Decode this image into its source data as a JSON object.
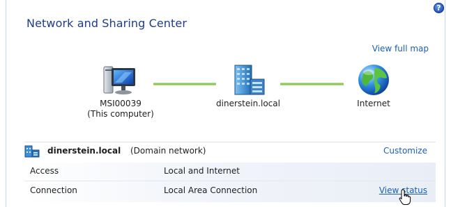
{
  "header": {
    "title": "Network and Sharing Center",
    "help_glyph": "?",
    "view_full_map": "View full map"
  },
  "map": {
    "computer": {
      "name": "MSI00039",
      "subtitle": "(This computer)"
    },
    "domain": {
      "name": "dinerstein.local"
    },
    "internet": {
      "name": "Internet"
    }
  },
  "network": {
    "name": "dinerstein.local",
    "type": "(Domain network)",
    "customize": "Customize",
    "rows": [
      {
        "label": "Access",
        "value": "Local and Internet",
        "action": ""
      },
      {
        "label": "Connection",
        "value": "Local Area Connection",
        "action": "View status"
      }
    ]
  },
  "colors": {
    "title": "#1e3c8c",
    "link": "#1a5fb4",
    "connection_line": "#78c03a"
  },
  "icons": [
    "help-icon",
    "computer-icon",
    "domain-server-icon",
    "internet-globe-icon",
    "domain-network-icon",
    "hand-pointer-cursor"
  ]
}
